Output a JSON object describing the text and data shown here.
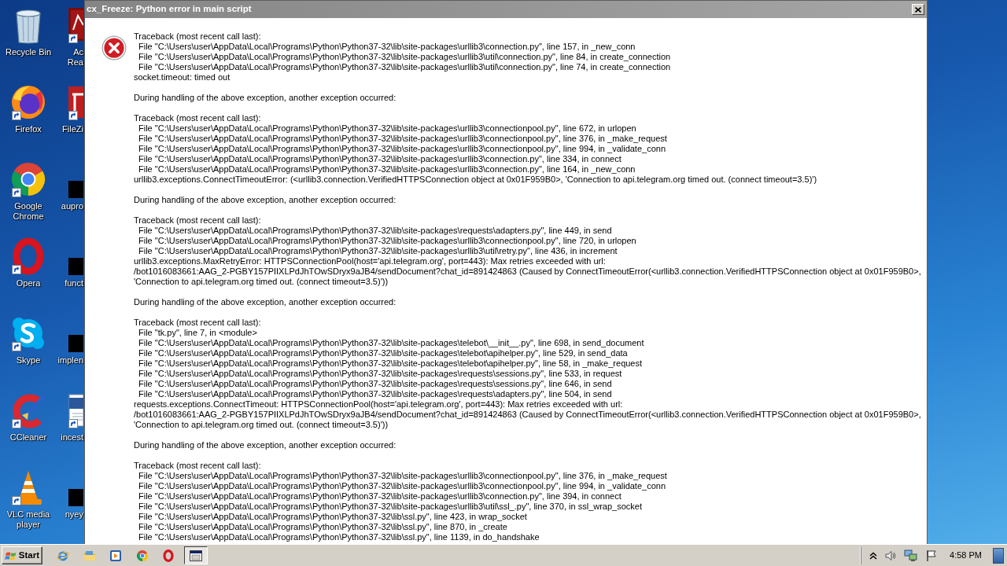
{
  "desktop": {
    "icons": [
      {
        "kind": "bin",
        "label": "Recycle Bin",
        "shortcut": false
      },
      {
        "kind": "fox",
        "label": "Firefox",
        "shortcut": true
      },
      {
        "kind": "wheel",
        "label": "Google Chrome",
        "shortcut": true
      },
      {
        "kind": "ring",
        "label": "Opera",
        "shortcut": true
      },
      {
        "kind": "cloud",
        "label": "Skype",
        "shortcut": true
      },
      {
        "kind": "brush",
        "label": "CCleaner",
        "shortcut": true
      },
      {
        "kind": "cone",
        "label": "VLC media player",
        "shortcut": true
      }
    ],
    "icons_behind_window": [
      {
        "kind": "reader",
        "label": "Ac Rea",
        "shortcut": true
      },
      {
        "kind": "tile",
        "label": "FileZi",
        "shortcut": true
      },
      {
        "kind": "blank",
        "label": "aupro",
        "shortcut": false
      },
      {
        "kind": "blank",
        "label": "funct",
        "shortcut": false
      },
      {
        "kind": "blank",
        "label": "implen",
        "shortcut": false
      },
      {
        "kind": "doc",
        "label": "incest",
        "shortcut": true
      },
      {
        "kind": "blank",
        "label": "nyey",
        "shortcut": false
      }
    ]
  },
  "dialog": {
    "title": "cx_Freeze: Python error in main script",
    "sections": [
      {
        "kind": "traceback",
        "header": "Traceback (most recent call last):",
        "frames": [
          "File \"C:\\Users\\user\\AppData\\Local\\Programs\\Python\\Python37-32\\lib\\site-packages\\urllib3\\connection.py\", line 157, in _new_conn",
          "File \"C:\\Users\\user\\AppData\\Local\\Programs\\Python\\Python37-32\\lib\\site-packages\\urllib3\\util\\connection.py\", line 84, in create_connection",
          "File \"C:\\Users\\user\\AppData\\Local\\Programs\\Python\\Python37-32\\lib\\site-packages\\urllib3\\util\\connection.py\", line 74, in create_connection"
        ],
        "error_lines": [
          "socket.timeout: timed out"
        ]
      },
      {
        "kind": "note",
        "text": "During handling of the above exception, another exception occurred:"
      },
      {
        "kind": "traceback",
        "header": "Traceback (most recent call last):",
        "frames": [
          "File \"C:\\Users\\user\\AppData\\Local\\Programs\\Python\\Python37-32\\lib\\site-packages\\urllib3\\connectionpool.py\", line 672, in urlopen",
          "File \"C:\\Users\\user\\AppData\\Local\\Programs\\Python\\Python37-32\\lib\\site-packages\\urllib3\\connectionpool.py\", line 376, in _make_request",
          "File \"C:\\Users\\user\\AppData\\Local\\Programs\\Python\\Python37-32\\lib\\site-packages\\urllib3\\connectionpool.py\", line 994, in _validate_conn",
          "File \"C:\\Users\\user\\AppData\\Local\\Programs\\Python\\Python37-32\\lib\\site-packages\\urllib3\\connection.py\", line 334, in connect",
          "File \"C:\\Users\\user\\AppData\\Local\\Programs\\Python\\Python37-32\\lib\\site-packages\\urllib3\\connection.py\", line 164, in _new_conn"
        ],
        "error_lines": [
          "urllib3.exceptions.ConnectTimeoutError: (<urllib3.connection.VerifiedHTTPSConnection object at 0x01F959B0>, 'Connection to api.telegram.org timed out. (connect timeout=3.5)')"
        ]
      },
      {
        "kind": "note",
        "text": "During handling of the above exception, another exception occurred:"
      },
      {
        "kind": "traceback",
        "header": "Traceback (most recent call last):",
        "frames": [
          "File \"C:\\Users\\user\\AppData\\Local\\Programs\\Python\\Python37-32\\lib\\site-packages\\requests\\adapters.py\", line 449, in send",
          "File \"C:\\Users\\user\\AppData\\Local\\Programs\\Python\\Python37-32\\lib\\site-packages\\urllib3\\connectionpool.py\", line 720, in urlopen",
          "File \"C:\\Users\\user\\AppData\\Local\\Programs\\Python\\Python37-32\\lib\\site-packages\\urllib3\\util\\retry.py\", line 436, in increment"
        ],
        "error_lines": [
          "urllib3.exceptions.MaxRetryError: HTTPSConnectionPool(host='api.telegram.org', port=443): Max retries exceeded with url:",
          "/bot1016083661:AAG_2-PGBY157PIIXLPdJhTOwSDryx9aJB4/sendDocument?chat_id=891424863 (Caused by ConnectTimeoutError(<urllib3.connection.VerifiedHTTPSConnection object at 0x01F959B0>,",
          "'Connection to api.telegram.org timed out. (connect timeout=3.5)'))"
        ]
      },
      {
        "kind": "note",
        "text": "During handling of the above exception, another exception occurred:"
      },
      {
        "kind": "traceback",
        "header": "Traceback (most recent call last):",
        "frames": [
          "File \"tk.py\", line 7, in <module>",
          "File \"C:\\Users\\user\\AppData\\Local\\Programs\\Python\\Python37-32\\lib\\site-packages\\telebot\\__init__.py\", line 698, in send_document",
          "File \"C:\\Users\\user\\AppData\\Local\\Programs\\Python\\Python37-32\\lib\\site-packages\\telebot\\apihelper.py\", line 529, in send_data",
          "File \"C:\\Users\\user\\AppData\\Local\\Programs\\Python\\Python37-32\\lib\\site-packages\\telebot\\apihelper.py\", line 58, in _make_request",
          "File \"C:\\Users\\user\\AppData\\Local\\Programs\\Python\\Python37-32\\lib\\site-packages\\requests\\sessions.py\", line 533, in request",
          "File \"C:\\Users\\user\\AppData\\Local\\Programs\\Python\\Python37-32\\lib\\site-packages\\requests\\sessions.py\", line 646, in send",
          "File \"C:\\Users\\user\\AppData\\Local\\Programs\\Python\\Python37-32\\lib\\site-packages\\requests\\adapters.py\", line 504, in send"
        ],
        "error_lines": [
          "requests.exceptions.ConnectTimeout: HTTPSConnectionPool(host='api.telegram.org', port=443): Max retries exceeded with url:",
          "/bot1016083661:AAG_2-PGBY157PIIXLPdJhTOwSDryx9aJB4/sendDocument?chat_id=891424863 (Caused by ConnectTimeoutError(<urllib3.connection.VerifiedHTTPSConnection object at 0x01F959B0>,",
          "'Connection to api.telegram.org timed out. (connect timeout=3.5)'))"
        ]
      },
      {
        "kind": "note",
        "text": "During handling of the above exception, another exception occurred:"
      },
      {
        "kind": "traceback",
        "header": "Traceback (most recent call last):",
        "frames": [
          "File \"C:\\Users\\user\\AppData\\Local\\Programs\\Python\\Python37-32\\lib\\site-packages\\urllib3\\connectionpool.py\", line 376, in _make_request",
          "File \"C:\\Users\\user\\AppData\\Local\\Programs\\Python\\Python37-32\\lib\\site-packages\\urllib3\\connectionpool.py\", line 994, in _validate_conn",
          "File \"C:\\Users\\user\\AppData\\Local\\Programs\\Python\\Python37-32\\lib\\site-packages\\urllib3\\connection.py\", line 394, in connect",
          "File \"C:\\Users\\user\\AppData\\Local\\Programs\\Python\\Python37-32\\lib\\site-packages\\urllib3\\util\\ssl_.py\", line 370, in ssl_wrap_socket",
          "File \"C:\\Users\\user\\AppData\\Local\\Programs\\Python\\Python37-32\\lib\\ssl.py\", line 423, in wrap_socket",
          "File \"C:\\Users\\user\\AppData\\Local\\Programs\\Python\\Python37-32\\lib\\ssl.py\", line 870, in _create",
          "File \"C:\\Users\\user\\AppData\\Local\\Programs\\Python\\Python37-32\\lib\\ssl.py\", line 1139, in do_handshake"
        ]
      }
    ]
  },
  "taskbar": {
    "start": "Start",
    "quick_launch": [
      {
        "kind": "globe"
      },
      {
        "kind": "folder"
      },
      {
        "kind": "player"
      },
      {
        "kind": "wheel"
      },
      {
        "kind": "ring"
      }
    ],
    "tasks": [
      {
        "selected": true
      }
    ],
    "tray": {
      "icons": [
        {
          "kind": "chevron"
        },
        {
          "kind": "speaker"
        },
        {
          "kind": "network"
        },
        {
          "kind": "flag"
        }
      ],
      "time": "4:58 PM"
    }
  }
}
